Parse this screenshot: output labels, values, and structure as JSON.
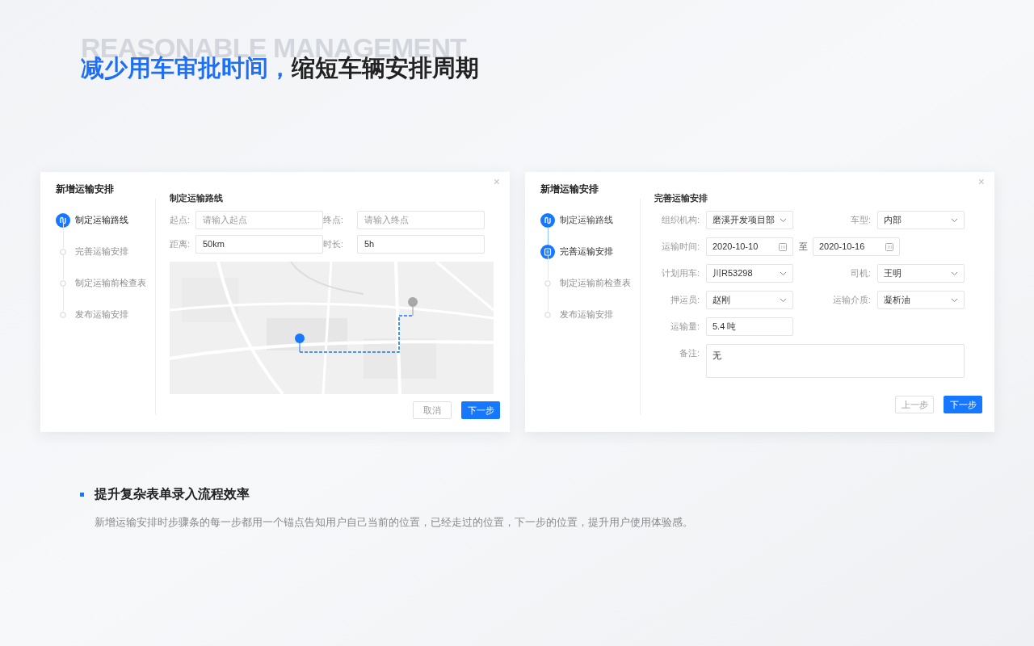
{
  "backdrop_text": "REASONABLE MANAGEMENT",
  "headline": {
    "highlight": "减少用车审批时间，",
    "rest": "缩短车辆安排周期"
  },
  "dialogs": [
    {
      "title": "新增运输安排",
      "close": "×",
      "section_title": "制定运输路线",
      "kind": "route",
      "steps": [
        {
          "label": "制定运输路线",
          "done": false,
          "selected": true
        },
        {
          "label": "完善运输安排",
          "done": false,
          "selected": false
        },
        {
          "label": "制定运输前检查表",
          "done": false,
          "selected": false
        },
        {
          "label": "发布运输安排",
          "done": false,
          "selected": false
        }
      ],
      "fields": [
        {
          "label": "起点:",
          "placeholder": "请输入起点"
        },
        {
          "label": "终点:",
          "placeholder": "请输入终点"
        },
        {
          "label": "距离:",
          "value": "50km"
        },
        {
          "label": "时长:",
          "value": "5h"
        }
      ],
      "buttons": [
        {
          "label": "取消",
          "primary": false
        },
        {
          "label": "下一步",
          "primary": true
        }
      ]
    },
    {
      "title": "新增运输安排",
      "close": "×",
      "section_title": "完善运输安排",
      "kind": "form",
      "steps": [
        {
          "label": "制定运输路线",
          "done": true,
          "selected": false
        },
        {
          "label": "完善运输安排",
          "done": false,
          "selected": true
        },
        {
          "label": "制定运输前检查表",
          "done": false,
          "selected": false
        },
        {
          "label": "发布运输安排",
          "done": false,
          "selected": false
        }
      ],
      "rows": [
        {
          "fields": [
            {
              "label": "组织机构:",
              "value": "磨溪开发项目部",
              "kind": "select"
            },
            {
              "label": "车型:",
              "value": "内部",
              "kind": "select"
            }
          ]
        },
        {
          "fields": [
            {
              "label": "运输时间:",
              "value": "2020-10-10",
              "kind": "date"
            },
            {
              "label": "至",
              "value": "2020-10-16",
              "kind": "date"
            }
          ],
          "kind": "range"
        },
        {
          "fields": [
            {
              "label": "计划用车:",
              "value": "川R53298",
              "kind": "select"
            },
            {
              "label": "司机:",
              "value": "王明",
              "kind": "select"
            }
          ]
        },
        {
          "fields": [
            {
              "label": "押运员:",
              "value": "赵刚",
              "kind": "select"
            },
            {
              "label": "运输介质:",
              "value": "凝析油",
              "kind": "select"
            }
          ]
        },
        {
          "fields": [
            {
              "label": "运输量:",
              "value": "5.4 吨",
              "kind": "text"
            }
          ]
        },
        {
          "fields": [
            {
              "label": "备注:",
              "value": "无",
              "kind": "textarea"
            }
          ]
        }
      ],
      "buttons": [
        {
          "label": "上一步",
          "primary": false
        },
        {
          "label": "下一步",
          "primary": true
        }
      ]
    }
  ],
  "feature": {
    "title": "提升复杂表单录入流程效率",
    "description": "新增运输安排时步骤条的每一步都用一个锚点告知用户自己当前的位置，已经走过的位置，下一步的位置，提升用户使用体验感。"
  }
}
